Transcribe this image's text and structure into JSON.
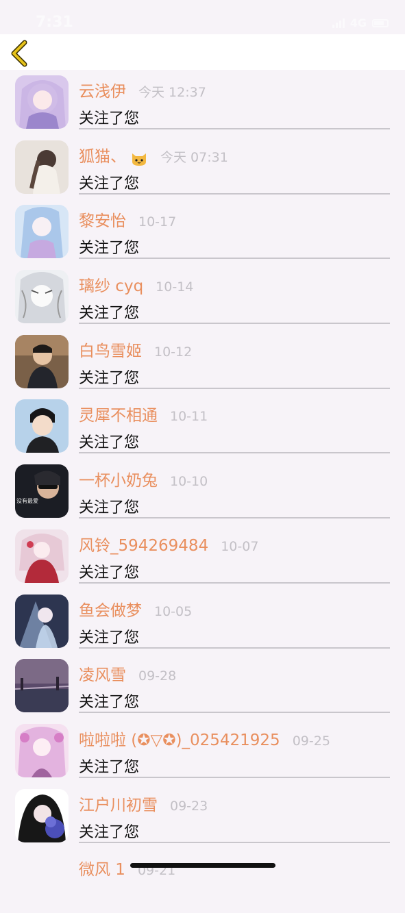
{
  "status_bar": {
    "time": "7:31",
    "network": "4G"
  },
  "nav": {
    "back_icon": "chevron-left-icon",
    "accent": "#e6c21a"
  },
  "colors": {
    "name": "#e98f5e",
    "time": "#c3c0c6",
    "action": "#111111",
    "background": "#f7f3f8"
  },
  "items": [
    {
      "name": "云浅伊",
      "time": "今天 12:37",
      "action": "关注了您"
    },
    {
      "name": "狐猫、",
      "time": "今天 07:31",
      "action": "关注了您",
      "emoji": "cat-face-icon"
    },
    {
      "name": "黎安怡",
      "time": "10-17",
      "action": "关注了您"
    },
    {
      "name": "璃纱 cyq",
      "time": "10-14",
      "action": "关注了您"
    },
    {
      "name": "白鸟雪姬",
      "time": "10-12",
      "action": "关注了您"
    },
    {
      "name": "灵犀不相通",
      "time": "10-11",
      "action": "关注了您"
    },
    {
      "name": "一杯小奶兔",
      "time": "10-10",
      "action": "关注了您"
    },
    {
      "name": "风铃_594269484",
      "time": "10-07",
      "action": "关注了您"
    },
    {
      "name": "鱼会做梦",
      "time": "10-05",
      "action": "关注了您"
    },
    {
      "name": "凌风雪",
      "time": "09-28",
      "action": "关注了您"
    },
    {
      "name": "啦啦啦 (✪▽✪)_025421925",
      "time": "09-25",
      "action": "关注了您"
    },
    {
      "name": "江户川初雪",
      "time": "09-23",
      "action": "关注了您"
    },
    {
      "name": "微风 1",
      "time": "09-21",
      "action": ""
    }
  ]
}
